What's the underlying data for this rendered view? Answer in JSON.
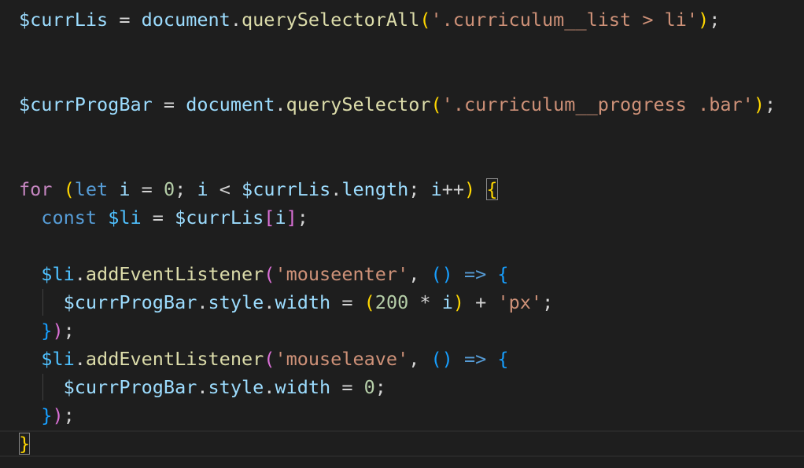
{
  "colors": {
    "background": "#1e1e1e",
    "variable": "#9cdcfe",
    "function": "#dcdcaa",
    "string": "#ce9178",
    "keyword_control": "#c586c0",
    "keyword_storage": "#569cd6",
    "number": "#b5cea8",
    "operator": "#d4d4d4",
    "bracket_gold": "#ffd700",
    "bracket_pink": "#da70d6",
    "bracket_blue": "#179fff",
    "constant": "#4fc1ff"
  },
  "lines": [
    {
      "tokens": [
        {
          "t": "$currLis",
          "c": "variable"
        },
        {
          "t": " = ",
          "c": "operator"
        },
        {
          "t": "document",
          "c": "variable"
        },
        {
          "t": ".",
          "c": "operator"
        },
        {
          "t": "querySelectorAll",
          "c": "function"
        },
        {
          "t": "(",
          "c": "bracket_gold"
        },
        {
          "t": "'.curriculum__list > li'",
          "c": "string"
        },
        {
          "t": ")",
          "c": "bracket_gold"
        },
        {
          "t": ";",
          "c": "operator"
        }
      ]
    },
    {
      "tokens": []
    },
    {
      "tokens": []
    },
    {
      "tokens": [
        {
          "t": "$currProgBar",
          "c": "variable"
        },
        {
          "t": " = ",
          "c": "operator"
        },
        {
          "t": "document",
          "c": "variable"
        },
        {
          "t": ".",
          "c": "operator"
        },
        {
          "t": "querySelector",
          "c": "function"
        },
        {
          "t": "(",
          "c": "bracket_gold"
        },
        {
          "t": "'.curriculum__progress .bar'",
          "c": "string"
        },
        {
          "t": ")",
          "c": "bracket_gold"
        },
        {
          "t": ";",
          "c": "operator"
        }
      ]
    },
    {
      "tokens": []
    },
    {
      "tokens": []
    },
    {
      "tokens": [
        {
          "t": "for",
          "c": "keyword_control"
        },
        {
          "t": " ",
          "c": "operator"
        },
        {
          "t": "(",
          "c": "bracket_gold"
        },
        {
          "t": "let",
          "c": "keyword_storage"
        },
        {
          "t": " ",
          "c": "operator"
        },
        {
          "t": "i",
          "c": "variable"
        },
        {
          "t": " = ",
          "c": "operator"
        },
        {
          "t": "0",
          "c": "number"
        },
        {
          "t": "; ",
          "c": "operator"
        },
        {
          "t": "i",
          "c": "variable"
        },
        {
          "t": " < ",
          "c": "operator"
        },
        {
          "t": "$currLis",
          "c": "variable"
        },
        {
          "t": ".",
          "c": "operator"
        },
        {
          "t": "length",
          "c": "variable"
        },
        {
          "t": "; ",
          "c": "operator"
        },
        {
          "t": "i",
          "c": "variable"
        },
        {
          "t": "++",
          "c": "operator"
        },
        {
          "t": ")",
          "c": "bracket_gold"
        },
        {
          "t": " ",
          "c": "operator"
        },
        {
          "t": "{",
          "c": "bracket_gold",
          "match": true
        }
      ]
    },
    {
      "tokens": [
        {
          "t": "  ",
          "c": "operator"
        },
        {
          "t": "const",
          "c": "keyword_storage"
        },
        {
          "t": " ",
          "c": "operator"
        },
        {
          "t": "$li",
          "c": "constant"
        },
        {
          "t": " = ",
          "c": "operator"
        },
        {
          "t": "$currLis",
          "c": "variable"
        },
        {
          "t": "[",
          "c": "bracket_pink"
        },
        {
          "t": "i",
          "c": "variable"
        },
        {
          "t": "]",
          "c": "bracket_pink"
        },
        {
          "t": ";",
          "c": "operator"
        }
      ]
    },
    {
      "tokens": []
    },
    {
      "tokens": [
        {
          "t": "  ",
          "c": "operator"
        },
        {
          "t": "$li",
          "c": "constant"
        },
        {
          "t": ".",
          "c": "operator"
        },
        {
          "t": "addEventListener",
          "c": "function"
        },
        {
          "t": "(",
          "c": "bracket_pink"
        },
        {
          "t": "'mouseenter'",
          "c": "string"
        },
        {
          "t": ", ",
          "c": "operator"
        },
        {
          "t": "()",
          "c": "bracket_blue"
        },
        {
          "t": " ",
          "c": "operator"
        },
        {
          "t": "=>",
          "c": "keyword_storage"
        },
        {
          "t": " ",
          "c": "operator"
        },
        {
          "t": "{",
          "c": "bracket_blue"
        }
      ]
    },
    {
      "tokens": [
        {
          "t": "    ",
          "c": "operator"
        },
        {
          "t": "$currProgBar",
          "c": "variable"
        },
        {
          "t": ".",
          "c": "operator"
        },
        {
          "t": "style",
          "c": "variable"
        },
        {
          "t": ".",
          "c": "operator"
        },
        {
          "t": "width",
          "c": "variable"
        },
        {
          "t": " = ",
          "c": "operator"
        },
        {
          "t": "(",
          "c": "bracket_gold"
        },
        {
          "t": "200",
          "c": "number"
        },
        {
          "t": " * ",
          "c": "operator"
        },
        {
          "t": "i",
          "c": "variable"
        },
        {
          "t": ")",
          "c": "bracket_gold"
        },
        {
          "t": " + ",
          "c": "operator"
        },
        {
          "t": "'px'",
          "c": "string"
        },
        {
          "t": ";",
          "c": "operator"
        }
      ]
    },
    {
      "tokens": [
        {
          "t": "  ",
          "c": "operator"
        },
        {
          "t": "}",
          "c": "bracket_blue"
        },
        {
          "t": ")",
          "c": "bracket_pink"
        },
        {
          "t": ";",
          "c": "operator"
        }
      ]
    },
    {
      "tokens": [
        {
          "t": "  ",
          "c": "operator"
        },
        {
          "t": "$li",
          "c": "constant"
        },
        {
          "t": ".",
          "c": "operator"
        },
        {
          "t": "addEventListener",
          "c": "function"
        },
        {
          "t": "(",
          "c": "bracket_pink"
        },
        {
          "t": "'mouseleave'",
          "c": "string"
        },
        {
          "t": ", ",
          "c": "operator"
        },
        {
          "t": "()",
          "c": "bracket_blue"
        },
        {
          "t": " ",
          "c": "operator"
        },
        {
          "t": "=>",
          "c": "keyword_storage"
        },
        {
          "t": " ",
          "c": "operator"
        },
        {
          "t": "{",
          "c": "bracket_blue"
        }
      ]
    },
    {
      "tokens": [
        {
          "t": "    ",
          "c": "operator"
        },
        {
          "t": "$currProgBar",
          "c": "variable"
        },
        {
          "t": ".",
          "c": "operator"
        },
        {
          "t": "style",
          "c": "variable"
        },
        {
          "t": ".",
          "c": "operator"
        },
        {
          "t": "width",
          "c": "variable"
        },
        {
          "t": " = ",
          "c": "operator"
        },
        {
          "t": "0",
          "c": "number"
        },
        {
          "t": ";",
          "c": "operator"
        }
      ]
    },
    {
      "tokens": [
        {
          "t": "  ",
          "c": "operator"
        },
        {
          "t": "}",
          "c": "bracket_blue"
        },
        {
          "t": ")",
          "c": "bracket_pink"
        },
        {
          "t": ";",
          "c": "operator"
        }
      ]
    },
    {
      "tokens": [
        {
          "t": "}",
          "c": "bracket_gold",
          "match": true
        }
      ]
    }
  ]
}
